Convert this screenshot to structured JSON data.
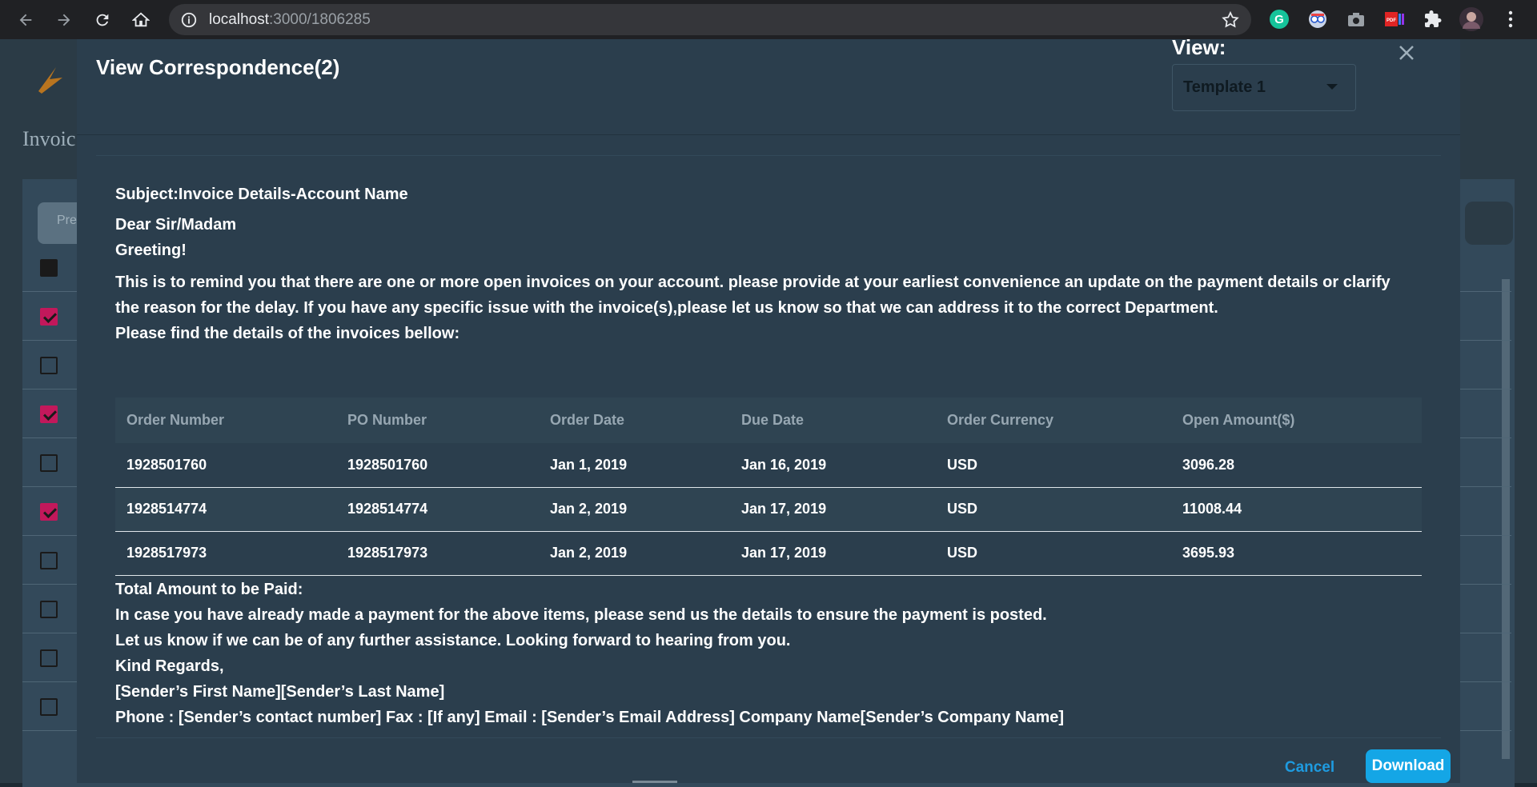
{
  "browser": {
    "url_host": "localhost",
    "url_path": ":3000/1806285"
  },
  "background": {
    "title": "Invoic",
    "button_label": "Pre",
    "rows": [
      {
        "checked": "indeterminate"
      },
      {
        "checked": true
      },
      {
        "checked": false
      },
      {
        "checked": true
      },
      {
        "checked": false
      },
      {
        "checked": true
      },
      {
        "checked": false
      },
      {
        "checked": false
      },
      {
        "checked": false
      },
      {
        "checked": false
      }
    ]
  },
  "modal": {
    "title": "View Correspondence(2)",
    "view_label": "View:",
    "template_value": "Template 1",
    "subject": "Subject:Invoice Details-Account Name",
    "salutation": "Dear Sir/Madam",
    "greeting": "Greeting!",
    "paragraph": "This is to remind you that there are one or more open invoices on your account. please provide at your earliest convenience an update on the payment details or clarify the reason for the delay. If you have any specific issue with the invoice(s),please let us know so that we can address it to the correct Department.",
    "find_details": "Please find the details of the invoices bellow:",
    "table": {
      "headers": [
        "Order Number",
        "PO Number",
        "Order Date",
        "Due Date",
        "Order Currency",
        "Open Amount($)"
      ],
      "rows": [
        [
          "1928501760",
          "1928501760",
          "Jan 1, 2019",
          "Jan 16, 2019",
          "USD",
          "3096.28"
        ],
        [
          "1928514774",
          "1928514774",
          "Jan 2, 2019",
          "Jan 17, 2019",
          "USD",
          "11008.44"
        ],
        [
          "1928517973",
          "1928517973",
          "Jan 2, 2019",
          "Jan 17, 2019",
          "USD",
          "3695.93"
        ]
      ]
    },
    "closing": [
      "Total Amount to be Paid:",
      "In case you have already made a payment for the above items, please send us the details to ensure the payment is posted.",
      "Let us know if we can be of any further assistance. Looking forward to hearing from you.",
      "Kind Regards,",
      "[Sender’s First Name][Sender’s Last Name]",
      "Phone : [Sender’s contact number] Fax : [If any] Email : [Sender’s Email Address] Company Name[Sender’s Company Name]"
    ],
    "cancel_label": "Cancel",
    "download_label": "Download"
  },
  "colors": {
    "accent": "#14a6e6",
    "checkbox_on": "#c2185b",
    "modal_bg": "#2b3e4d"
  }
}
